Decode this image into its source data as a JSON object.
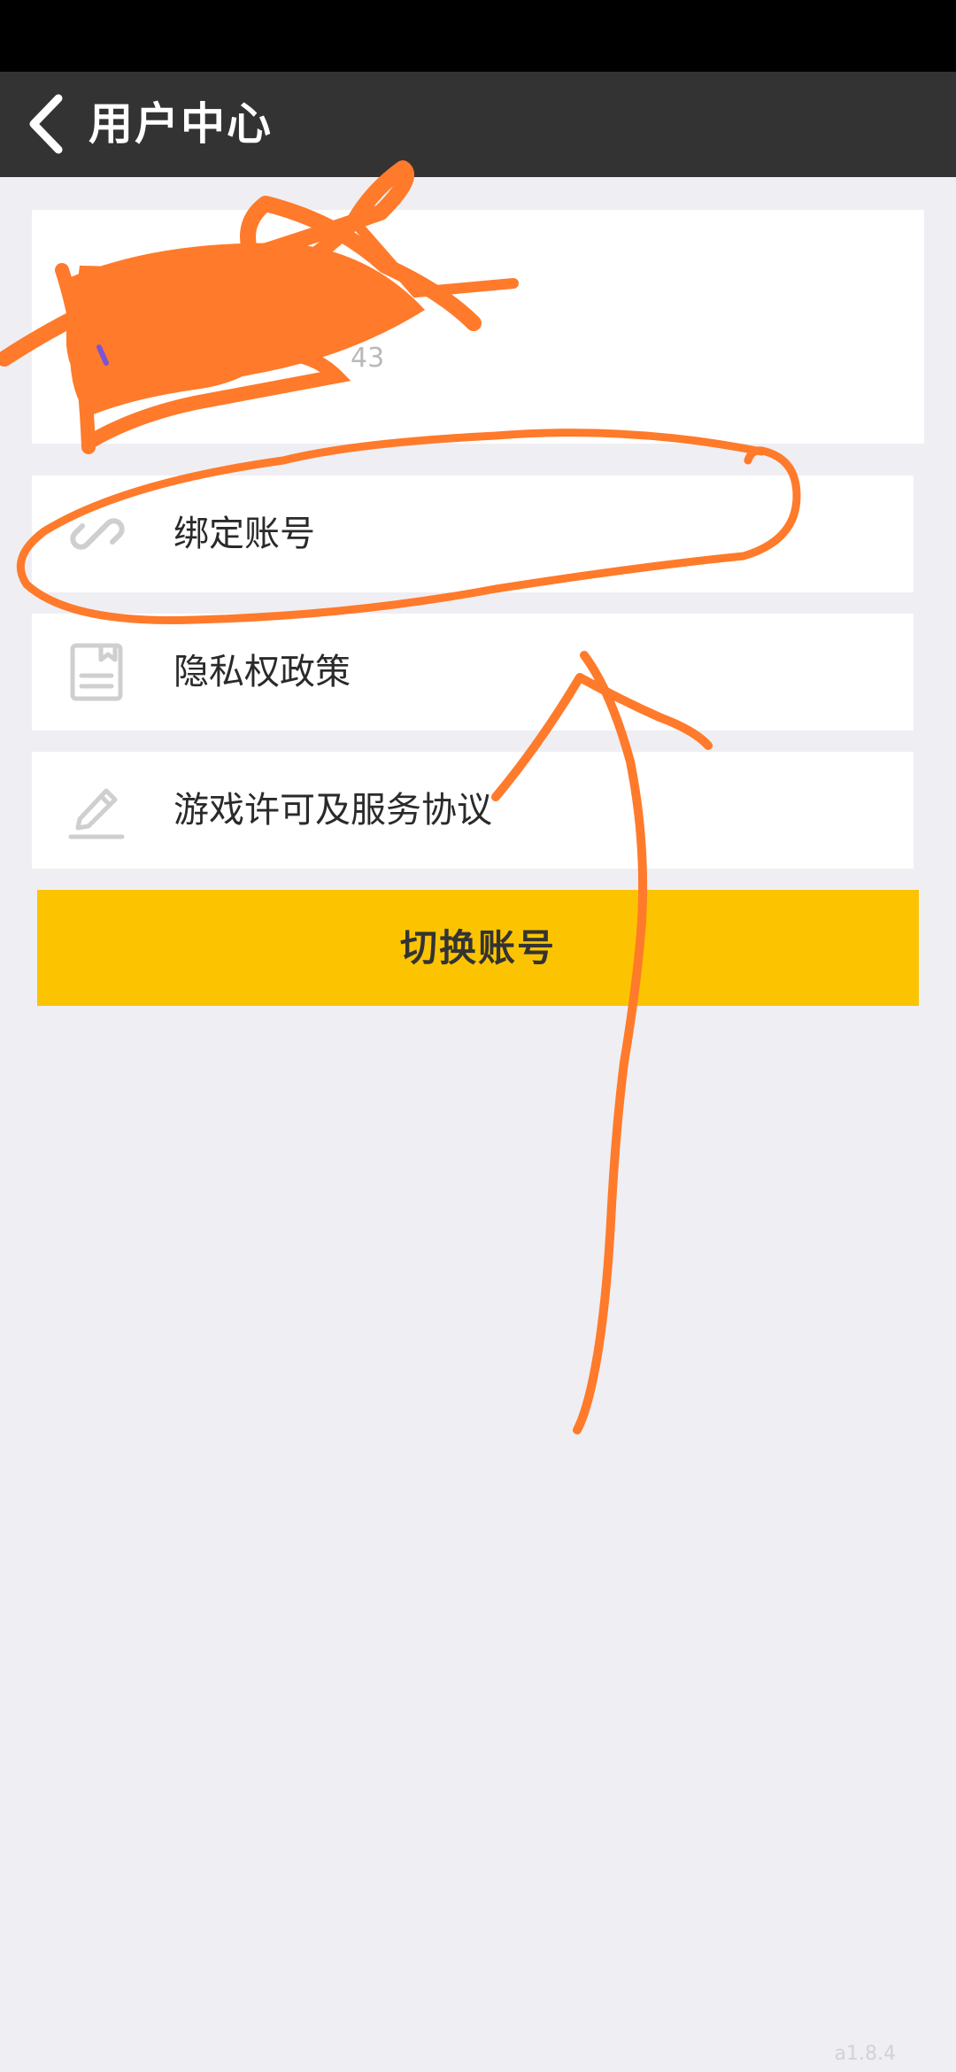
{
  "header": {
    "back_icon": "chevron-left-icon",
    "title": "用户中心"
  },
  "profile": {
    "partial_text": "43"
  },
  "menu": {
    "items": [
      {
        "label": "绑定账号",
        "icon": "link-icon"
      },
      {
        "label": "隐私权政策",
        "icon": "document-icon"
      },
      {
        "label": "游戏许可及服务协议",
        "icon": "pencil-icon"
      }
    ]
  },
  "switch_button": {
    "label": "切换账号",
    "color": "#fcc400"
  },
  "version": "a1.8.4",
  "annotation_color": "#ff7a2a",
  "colors": {
    "header_bg": "#333333",
    "page_bg": "#efeef3"
  }
}
